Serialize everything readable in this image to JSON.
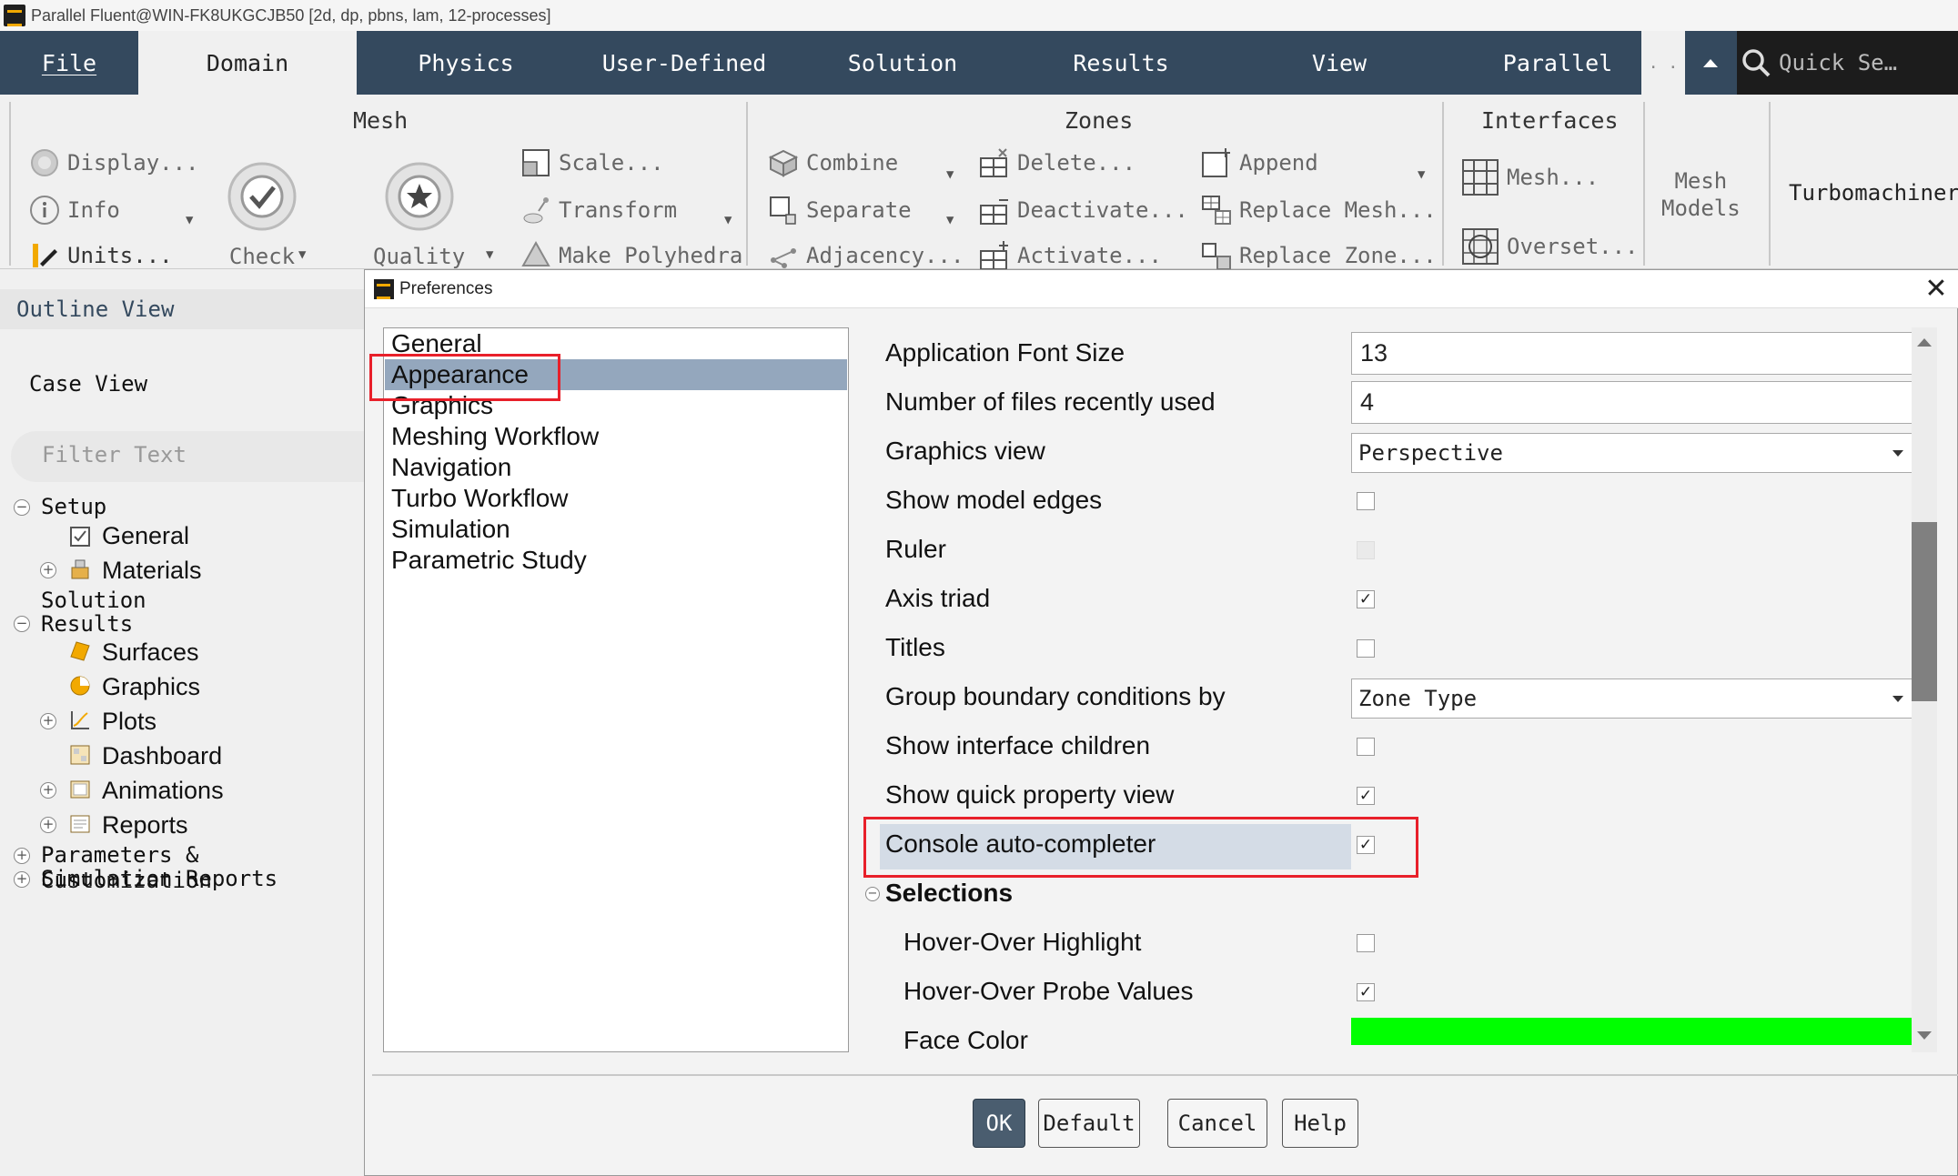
{
  "window": {
    "title": "Parallel Fluent@WIN-FK8UKGCJB50  [2d, dp, pbns, lam, 12-processes]"
  },
  "menubar": {
    "tabs": [
      "File",
      "Domain",
      "Physics",
      "User-Defined",
      "Solution",
      "Results",
      "View",
      "Parallel"
    ],
    "more": ". .",
    "search_placeholder": "Quick Se…"
  },
  "ribbon": {
    "mesh": {
      "title": "Mesh",
      "display": "Display...",
      "info": "Info",
      "units": "Units...",
      "check": "Check",
      "quality": "Quality",
      "scale": "Scale...",
      "transform": "Transform",
      "make_polyhedra": "Make Polyhedra"
    },
    "zones": {
      "title": "Zones",
      "combine": "Combine",
      "separate": "Separate",
      "adjacency": "Adjacency...",
      "delete": "Delete...",
      "deactivate": "Deactivate...",
      "activate": "Activate...",
      "append": "Append",
      "replace_mesh": "Replace Mesh...",
      "replace_zone": "Replace Zone..."
    },
    "interfaces": {
      "title": "Interfaces",
      "mesh": "Mesh...",
      "overset": "Overset..."
    },
    "mesh_models": {
      "line1": "Mesh",
      "line2": "Models"
    },
    "turbomachinery": "Turbomachinery"
  },
  "outline": {
    "title": "Outline View",
    "case_view": "Case View",
    "filter_placeholder": "Filter Text",
    "tree": {
      "setup": "Setup",
      "general": "General",
      "materials": "Materials",
      "solution": "Solution",
      "results": "Results",
      "surfaces": "Surfaces",
      "graphics": "Graphics",
      "plots": "Plots",
      "dashboard": "Dashboard",
      "animations": "Animations",
      "reports": "Reports",
      "params": "Parameters & Customization",
      "sim_reports": "Simulation Reports"
    }
  },
  "dialog": {
    "title": "Preferences",
    "close": "✕",
    "categories": [
      "General",
      "Appearance",
      "Graphics",
      "Meshing Workflow",
      "Navigation",
      "Turbo Workflow",
      "Simulation",
      "Parametric Study"
    ],
    "selected_category": "Appearance",
    "props": {
      "font_size_label": "Application Font Size",
      "font_size_value": "13",
      "recent_label": "Number of files recently used",
      "recent_value": "4",
      "graphics_view_label": "Graphics view",
      "graphics_view_value": "Perspective",
      "model_edges_label": "Show model edges",
      "model_edges": false,
      "ruler_label": "Ruler",
      "ruler": false,
      "axis_triad_label": "Axis triad",
      "axis_triad": true,
      "titles_label": "Titles",
      "titles": false,
      "group_bc_label": "Group boundary conditions by",
      "group_bc_value": "Zone Type",
      "iface_children_label": "Show interface children",
      "iface_children": false,
      "quick_prop_label": "Show quick property view",
      "quick_prop": true,
      "console_label": "Console auto-completer",
      "console": true,
      "selections_label": "Selections",
      "hover_highlight_label": "Hover-Over Highlight",
      "hover_highlight": false,
      "hover_probe_label": "Hover-Over Probe Values",
      "hover_probe": true,
      "face_color_label": "Face Color",
      "face_color": "#00ff00"
    },
    "buttons": {
      "ok": "OK",
      "default": "Default",
      "cancel": "Cancel",
      "help": "Help"
    }
  },
  "colors": {
    "menubar": "#34495e",
    "selection": "#94a7bd",
    "highlight_row": "#d4dce6",
    "annotation": "#e8202a"
  }
}
